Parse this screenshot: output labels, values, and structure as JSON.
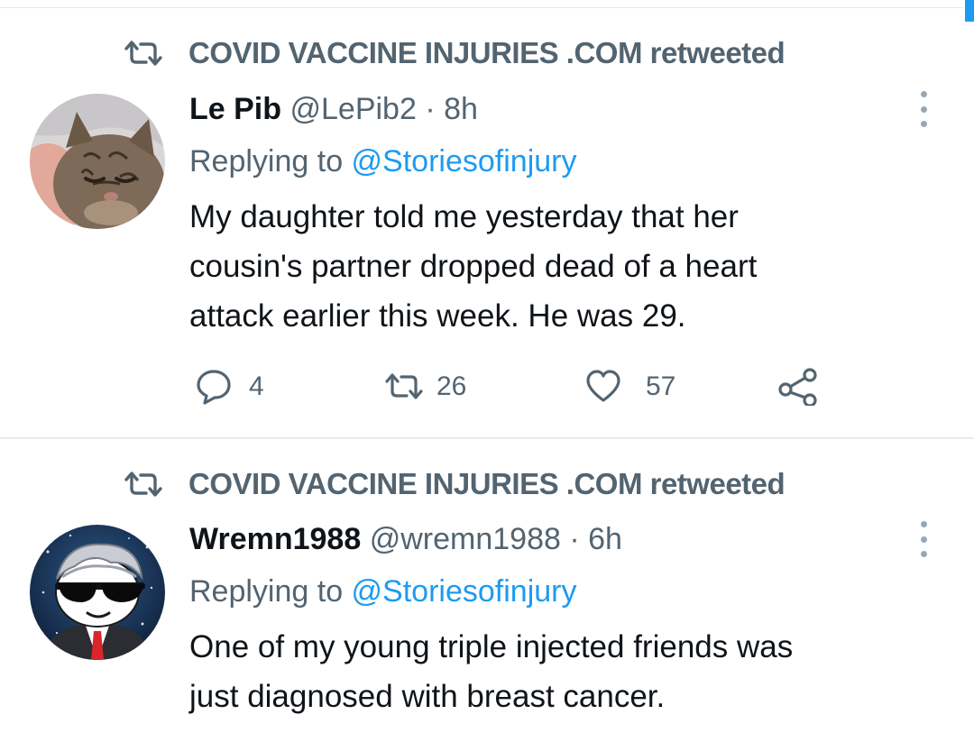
{
  "tweets": [
    {
      "retweeted_by": "COVID VACCINE INJURIES .COM retweeted",
      "display_name": "Le Pib",
      "handle": "@LePib2",
      "separator": "·",
      "time": "8h",
      "replying_prefix": "Replying to ",
      "replying_to": "@Storiesofinjury",
      "body_lines": [
        "My daughter told me yesterday that her",
        "cousin's partner dropped dead of a heart",
        "attack earlier this week. He was 29."
      ],
      "avatar_icon": "cat-avatar",
      "stats": {
        "replies": "4",
        "retweets": "26",
        "likes": "57"
      }
    },
    {
      "retweeted_by": "COVID VACCINE INJURIES .COM retweeted",
      "display_name": "Wremn1988",
      "handle": "@wremn1988",
      "separator": "·",
      "time": "6h",
      "replying_prefix": "Replying to ",
      "replying_to": "@Storiesofinjury",
      "body_lines": [
        "One of my young triple injected friends was",
        "just diagnosed with breast cancer."
      ],
      "avatar_icon": "reddit-snoo-sunglasses-avatar"
    }
  ],
  "colors": {
    "text_primary": "#0f1419",
    "text_secondary": "#536471",
    "accent": "#1d9bf0",
    "divider": "#e6ecf0"
  },
  "icons": {
    "retweet": "retweet-icon",
    "reply": "reply-icon",
    "like": "heart-icon",
    "share": "share-icon",
    "more": "more-icon"
  }
}
